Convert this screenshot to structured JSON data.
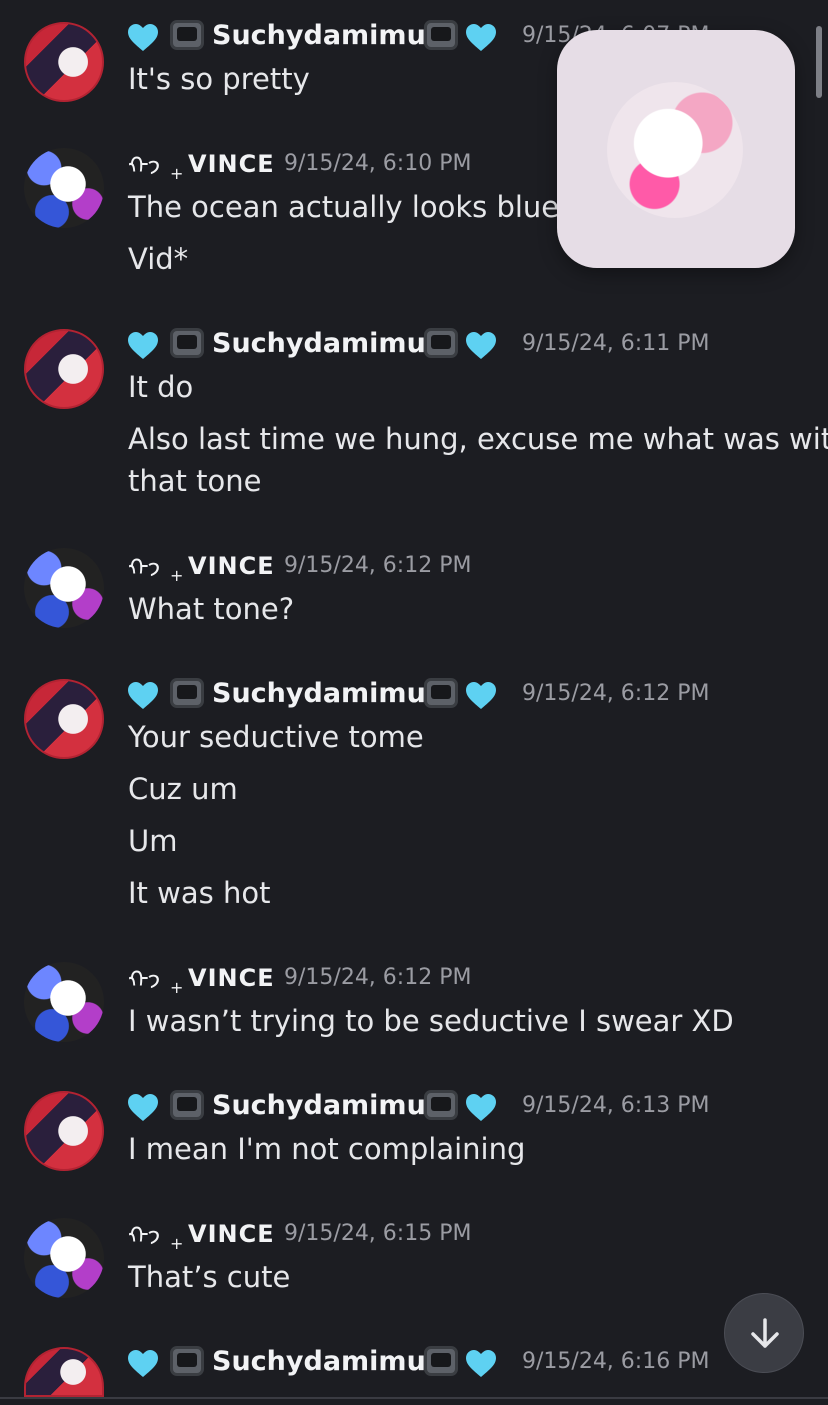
{
  "messages": [
    {
      "author": "Suchydamimus",
      "timestamp": "9/15/24, 6:07 PM",
      "lines": [
        "It's so pretty"
      ]
    },
    {
      "author": "VINCE",
      "glyph": "ᡣ𐭩",
      "timestamp": "9/15/24, 6:10 PM",
      "lines": [
        "The ocean actually looks blue in",
        "Vid*"
      ]
    },
    {
      "author": "Suchydamimus",
      "timestamp": "9/15/24, 6:11 PM",
      "lines": [
        "It do",
        "Also last time we hung, excuse me what was with",
        "that tone"
      ]
    },
    {
      "author": "VINCE",
      "glyph": "ᡣ𐭩",
      "timestamp": "9/15/24, 6:12 PM",
      "lines": [
        "What tone?"
      ]
    },
    {
      "author": "Suchydamimus",
      "timestamp": "9/15/24, 6:12 PM",
      "lines": [
        "Your seductive tome",
        "Cuz um",
        "Um",
        "It was hot"
      ]
    },
    {
      "author": "VINCE",
      "glyph": "ᡣ𐭩",
      "timestamp": "9/15/24, 6:12 PM",
      "lines": [
        "I wasn’t trying to be seductive I swear XD"
      ]
    },
    {
      "author": "Suchydamimus",
      "timestamp": "9/15/24, 6:13 PM",
      "lines": [
        "I mean I'm not complaining"
      ]
    },
    {
      "author": "VINCE",
      "glyph": "ᡣ𐭩",
      "timestamp": "9/15/24, 6:15 PM",
      "lines": [
        "That’s cute"
      ]
    },
    {
      "author": "Suchydamimus",
      "timestamp": "9/15/24, 6:16 PM",
      "lines": []
    }
  ],
  "icons": {
    "heart_color": "#5ed1f2",
    "jump_button_icon": "arrow-down-icon"
  },
  "colors": {
    "background": "#1c1d22",
    "text": "#e6e7ea",
    "muted": "#9b9ca3"
  }
}
